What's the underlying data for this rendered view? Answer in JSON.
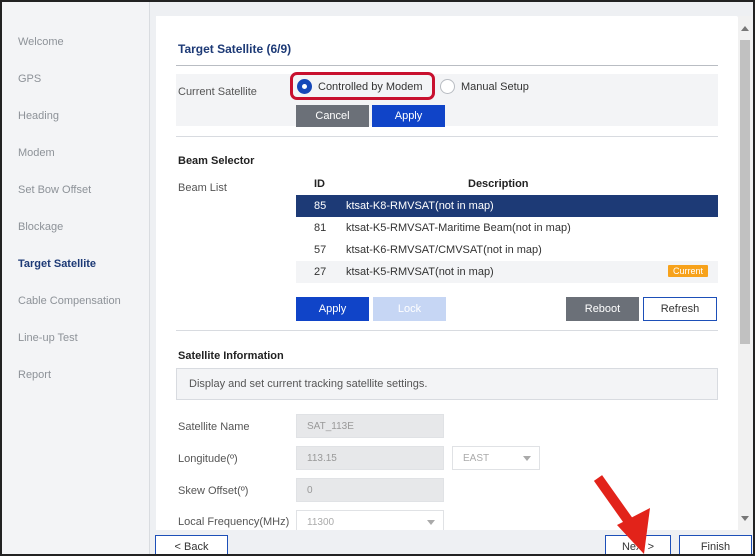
{
  "sidebar": {
    "items": [
      {
        "label": "Welcome"
      },
      {
        "label": "GPS"
      },
      {
        "label": "Heading"
      },
      {
        "label": "Modem"
      },
      {
        "label": "Set Bow Offset"
      },
      {
        "label": "Blockage"
      },
      {
        "label": "Target Satellite",
        "active": true
      },
      {
        "label": "Cable Compensation"
      },
      {
        "label": "Line-up Test"
      },
      {
        "label": "Report"
      }
    ]
  },
  "page": {
    "title": "Target Satellite (6/9)"
  },
  "current_satellite": {
    "label": "Current Satellite",
    "option_modem": "Controlled by Modem",
    "option_manual": "Manual Setup",
    "selected": "Controlled by Modem",
    "cancel_label": "Cancel",
    "apply_label": "Apply"
  },
  "beam_selector": {
    "title": "Beam Selector",
    "list_label": "Beam List",
    "col_id": "ID",
    "col_desc": "Description",
    "rows": [
      {
        "id": "85",
        "desc": "ktsat-K8-RMVSAT(not in map)",
        "badge": ""
      },
      {
        "id": "81",
        "desc": "ktsat-K5-RMVSAT-Maritime Beam(not in map)",
        "badge": ""
      },
      {
        "id": "57",
        "desc": "ktsat-K6-RMVSAT/CMVSAT(not in map)",
        "badge": ""
      },
      {
        "id": "27",
        "desc": "ktsat-K5-RMVSAT(not in map)",
        "badge": "Current"
      }
    ],
    "selected_id": "85",
    "apply_label": "Apply",
    "lock_label": "Lock",
    "reboot_label": "Reboot",
    "refresh_label": "Refresh"
  },
  "satellite_info": {
    "title": "Satellite Information",
    "description": "Display and set current tracking satellite settings.",
    "name_label": "Satellite Name",
    "name_value": "SAT_113E",
    "longitude_label": "Longitude(º)",
    "longitude_value": "113.15",
    "longitude_dir": "EAST",
    "skew_label": "Skew Offset(º)",
    "skew_value": "0",
    "local_freq_label": "Local Frequency(MHz)",
    "local_freq_value": "11300"
  },
  "footer": {
    "back_label": "< Back",
    "next_label": "Next >",
    "finish_label": "Finish"
  },
  "colors": {
    "accent": "#1d3a76",
    "primary_button": "#1044c8",
    "highlight": "#c8102e",
    "badge": "#f7a21b",
    "pointer_arrow": "#e2231a"
  }
}
